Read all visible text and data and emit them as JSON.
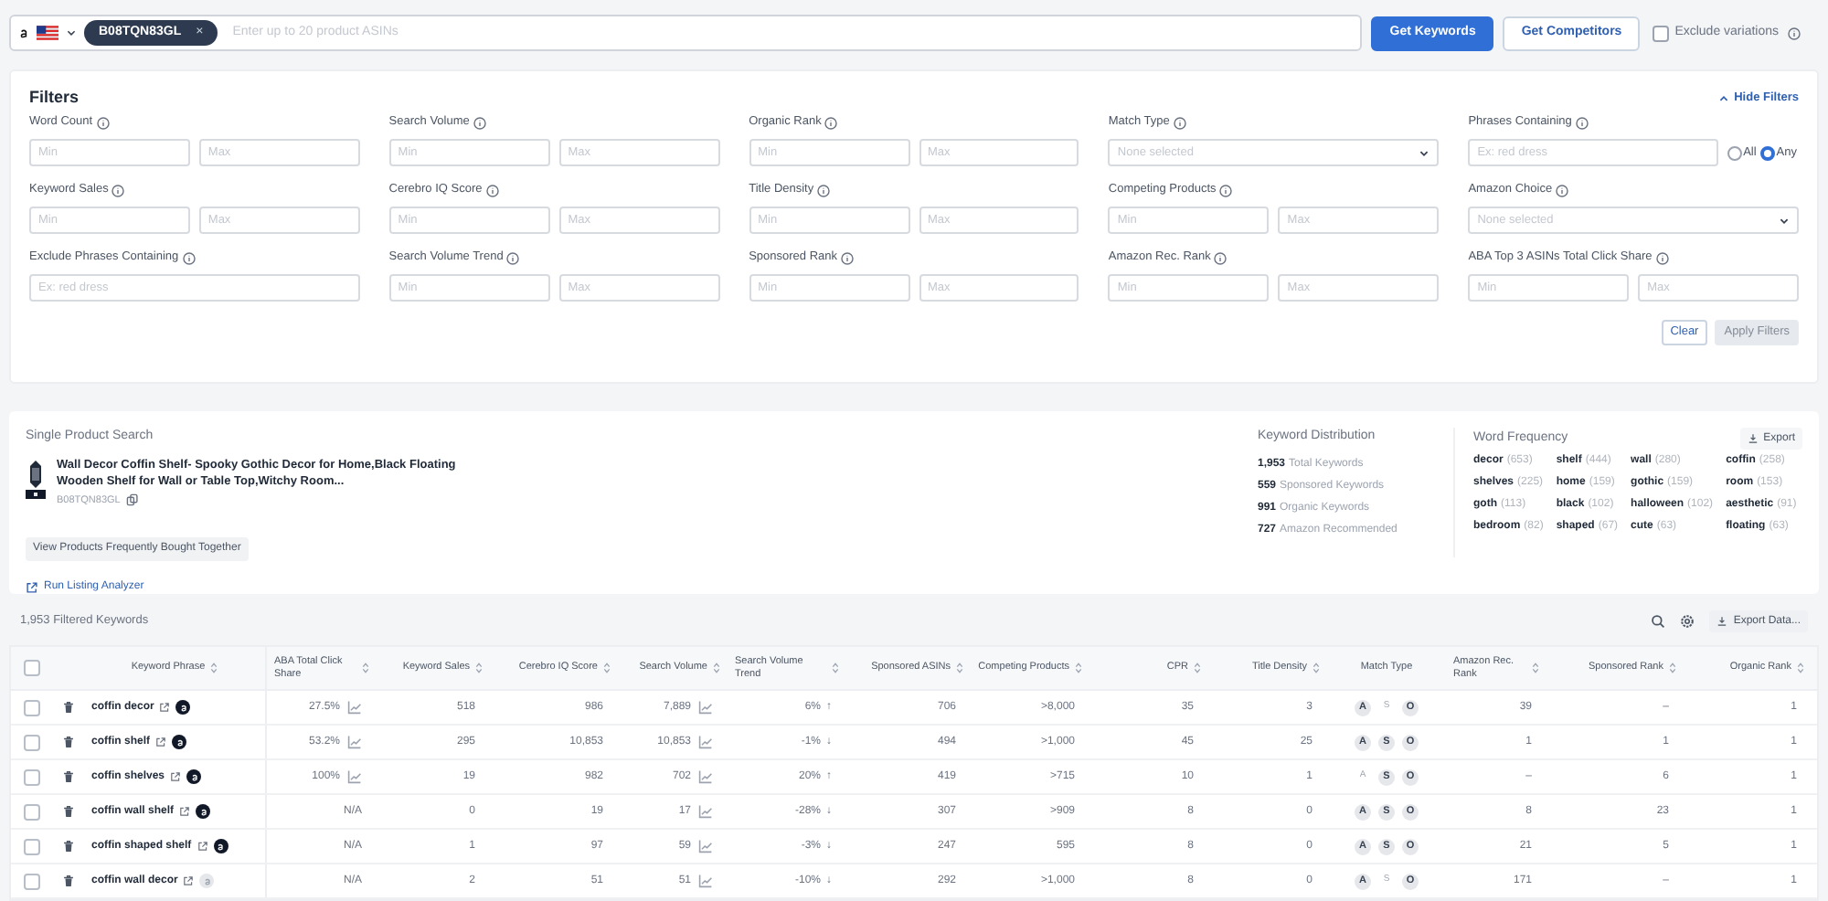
{
  "search_bar": {
    "asin_chip": "B08TQN83GL",
    "chip_close": "×",
    "placeholder": "Enter up to 20 product ASINs",
    "buttons": [
      {
        "label": "Get Keywords",
        "kind": "primary"
      },
      {
        "label": "Get Competitors",
        "kind": "outline"
      }
    ],
    "exclude_variations": {
      "label": "Exclude variations",
      "checked": false
    }
  },
  "filters": {
    "title": "Filters",
    "hide_link": "Hide Filters",
    "items": [
      {
        "label": "Word Count",
        "kind": "range",
        "min_placeholder": "Min",
        "max_placeholder": "Max"
      },
      {
        "label": "Search Volume",
        "kind": "range",
        "min_placeholder": "Min",
        "max_placeholder": "Max"
      },
      {
        "label": "Organic Rank",
        "kind": "range",
        "min_placeholder": "Min",
        "max_placeholder": "Max"
      },
      {
        "label": "Match Type",
        "kind": "select",
        "placeholder": "None selected"
      },
      {
        "label": "Phrases Containing",
        "kind": "text_radio",
        "placeholder": "Ex: red dress",
        "options": [
          {
            "label": "All",
            "selected": false
          },
          {
            "label": "Any",
            "selected": true
          }
        ]
      },
      {
        "label": "Keyword Sales",
        "kind": "range",
        "min_placeholder": "Min",
        "max_placeholder": "Max"
      },
      {
        "label": "Cerebro IQ Score",
        "kind": "range",
        "min_placeholder": "Min",
        "max_placeholder": "Max"
      },
      {
        "label": "Title Density",
        "kind": "range",
        "min_placeholder": "Min",
        "max_placeholder": "Max"
      },
      {
        "label": "Competing Products",
        "kind": "range",
        "min_placeholder": "Min",
        "max_placeholder": "Max"
      },
      {
        "label": "Amazon Choice",
        "kind": "select",
        "placeholder": "None selected"
      },
      {
        "label": "Exclude Phrases Containing",
        "kind": "text",
        "placeholder": "Ex: red dress"
      },
      {
        "label": "Search Volume Trend",
        "kind": "range",
        "min_placeholder": "Min",
        "max_placeholder": "Max"
      },
      {
        "label": "Sponsored Rank",
        "kind": "range",
        "min_placeholder": "Min",
        "max_placeholder": "Max"
      },
      {
        "label": "Amazon Rec. Rank",
        "kind": "range",
        "min_placeholder": "Min",
        "max_placeholder": "Max"
      },
      {
        "label": "ABA Top 3 ASINs Total Click Share",
        "kind": "range",
        "min_placeholder": "Min",
        "max_placeholder": "Max"
      }
    ],
    "buttons": [
      {
        "label": "Clear",
        "disabled": false
      },
      {
        "label": "Apply Filters",
        "disabled": true
      }
    ]
  },
  "product": {
    "heading": "Single Product Search",
    "title": "Wall Decor Coffin Shelf- Spooky Gothic Decor for Home,Black Floating Wooden Shelf for Wall or Table Top,Witchy Room...",
    "asin": "B08TQN83GL",
    "fbt_button": "View Products Frequently Bought Together",
    "analyzer_link": "Run Listing Analyzer"
  },
  "keyword_distribution": {
    "heading": "Keyword Distribution",
    "items": [
      {
        "value": "1,953",
        "label": "Total Keywords"
      },
      {
        "value": "559",
        "label": "Sponsored Keywords"
      },
      {
        "value": "991",
        "label": "Organic Keywords"
      },
      {
        "value": "727",
        "label": "Amazon Recommended"
      }
    ]
  },
  "word_frequency": {
    "heading": "Word Frequency",
    "export": "Export",
    "words": [
      {
        "word": "decor",
        "count": "(653)"
      },
      {
        "word": "shelf",
        "count": "(444)"
      },
      {
        "word": "wall",
        "count": "(280)"
      },
      {
        "word": "coffin",
        "count": "(258)"
      },
      {
        "word": "shelves",
        "count": "(225)"
      },
      {
        "word": "home",
        "count": "(159)"
      },
      {
        "word": "gothic",
        "count": "(159)"
      },
      {
        "word": "room",
        "count": "(153)"
      },
      {
        "word": "goth",
        "count": "(113)"
      },
      {
        "word": "black",
        "count": "(102)"
      },
      {
        "word": "halloween",
        "count": "(102)"
      },
      {
        "word": "aesthetic",
        "count": "(91)"
      },
      {
        "word": "bedroom",
        "count": "(82)"
      },
      {
        "word": "shaped",
        "count": "(67)"
      },
      {
        "word": "cute",
        "count": "(63)"
      },
      {
        "word": "floating",
        "count": "(63)"
      }
    ]
  },
  "table": {
    "count_label": "1,953 Filtered Keywords",
    "export": "Export Data...",
    "select_all_checked": false,
    "columns": [
      {
        "label": "Keyword Phrase",
        "sortable": true
      },
      {
        "label": "ABA Total Click Share",
        "sortable": true
      },
      {
        "label": "Keyword Sales",
        "sortable": true
      },
      {
        "label": "Cerebro IQ Score",
        "sortable": true
      },
      {
        "label": "Search Volume",
        "sortable": true
      },
      {
        "label": "Search Volume Trend",
        "sortable": true
      },
      {
        "label": "Sponsored ASINs",
        "sortable": true
      },
      {
        "label": "Competing Products",
        "sortable": true
      },
      {
        "label": "CPR",
        "sortable": true
      },
      {
        "label": "Title Density",
        "sortable": true
      },
      {
        "label": "Match Type",
        "sortable": false
      },
      {
        "label": "Amazon Rec. Rank",
        "sortable": true
      },
      {
        "label": "Sponsored Rank",
        "sortable": true
      },
      {
        "label": "Organic Rank",
        "sortable": true
      }
    ],
    "rows": [
      {
        "keyword": "coffin decor",
        "badge_active": true,
        "aba": "27.5%",
        "aba_chart": true,
        "sales": "518",
        "iq": "986",
        "volume": "7,889",
        "trend": "6%",
        "trend_arrow": "↑",
        "sponsored_asins": "706",
        "competing": ">8,000",
        "cpr": "35",
        "title_density": "3",
        "match": [
          {
            "letter": "A",
            "on": true
          },
          {
            "letter": "S",
            "on": false
          },
          {
            "letter": "O",
            "on": true
          }
        ],
        "rec_rank": "39",
        "sponsored_rank": "–",
        "organic_rank": "1",
        "checked": false
      },
      {
        "keyword": "coffin shelf",
        "badge_active": true,
        "aba": "53.2%",
        "aba_chart": true,
        "sales": "295",
        "iq": "10,853",
        "volume": "10,853",
        "trend": "-1%",
        "trend_arrow": "↓",
        "sponsored_asins": "494",
        "competing": ">1,000",
        "cpr": "45",
        "title_density": "25",
        "match": [
          {
            "letter": "A",
            "on": true
          },
          {
            "letter": "S",
            "on": true
          },
          {
            "letter": "O",
            "on": true
          }
        ],
        "rec_rank": "1",
        "sponsored_rank": "1",
        "organic_rank": "1",
        "checked": false
      },
      {
        "keyword": "coffin shelves",
        "badge_active": true,
        "aba": "100%",
        "aba_chart": true,
        "sales": "19",
        "iq": "982",
        "volume": "702",
        "trend": "20%",
        "trend_arrow": "↑",
        "sponsored_asins": "419",
        "competing": ">715",
        "cpr": "10",
        "title_density": "1",
        "match": [
          {
            "letter": "A",
            "on": false
          },
          {
            "letter": "S",
            "on": true
          },
          {
            "letter": "O",
            "on": true
          }
        ],
        "rec_rank": "–",
        "sponsored_rank": "6",
        "organic_rank": "1",
        "checked": false
      },
      {
        "keyword": "coffin wall shelf",
        "badge_active": true,
        "aba": "N/A",
        "aba_chart": false,
        "sales": "0",
        "iq": "19",
        "volume": "17",
        "trend": "-28%",
        "trend_arrow": "↓",
        "sponsored_asins": "307",
        "competing": ">909",
        "cpr": "8",
        "title_density": "0",
        "match": [
          {
            "letter": "A",
            "on": true
          },
          {
            "letter": "S",
            "on": true
          },
          {
            "letter": "O",
            "on": true
          }
        ],
        "rec_rank": "8",
        "sponsored_rank": "23",
        "organic_rank": "1",
        "checked": false
      },
      {
        "keyword": "coffin shaped shelf",
        "badge_active": true,
        "aba": "N/A",
        "aba_chart": false,
        "sales": "1",
        "iq": "97",
        "volume": "59",
        "trend": "-3%",
        "trend_arrow": "↓",
        "sponsored_asins": "247",
        "competing": "595",
        "cpr": "8",
        "title_density": "0",
        "match": [
          {
            "letter": "A",
            "on": true
          },
          {
            "letter": "S",
            "on": true
          },
          {
            "letter": "O",
            "on": true
          }
        ],
        "rec_rank": "21",
        "sponsored_rank": "5",
        "organic_rank": "1",
        "checked": false
      },
      {
        "keyword": "coffin wall decor",
        "badge_active": false,
        "aba": "N/A",
        "aba_chart": false,
        "sales": "2",
        "iq": "51",
        "volume": "51",
        "trend": "-10%",
        "trend_arrow": "↓",
        "sponsored_asins": "292",
        "competing": ">1,000",
        "cpr": "8",
        "title_density": "0",
        "match": [
          {
            "letter": "A",
            "on": true
          },
          {
            "letter": "S",
            "on": false
          },
          {
            "letter": "O",
            "on": true
          }
        ],
        "rec_rank": "171",
        "sponsored_rank": "–",
        "organic_rank": "1",
        "checked": false
      }
    ]
  }
}
